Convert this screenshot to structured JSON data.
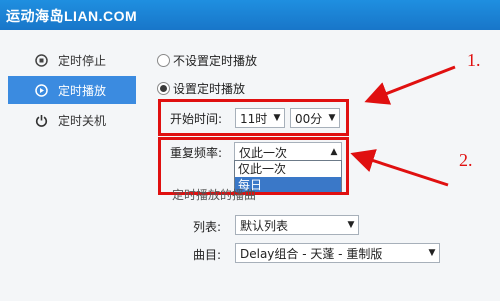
{
  "window": {
    "title": "运动海岛LIAN.COM"
  },
  "sidebar": {
    "items": [
      {
        "label": "定时停止",
        "icon": "stop-circle-icon",
        "active": false
      },
      {
        "label": "定时播放",
        "icon": "play-circle-icon",
        "active": true
      },
      {
        "label": "定时关机",
        "icon": "power-icon",
        "active": false
      }
    ]
  },
  "options": {
    "no_schedule": "不设置定时播放",
    "set_schedule": "设置定时播放",
    "selected": "设置定时播放"
  },
  "start_time": {
    "label": "开始时间:",
    "hour": "11时",
    "minute": "00分"
  },
  "repeat": {
    "label": "重复频率:",
    "value": "仅此一次",
    "options": [
      "仅此一次",
      "每日"
    ],
    "highlighted": "每日"
  },
  "playlist_section": {
    "heading": "定时播放的播曲",
    "list_label": "列表:",
    "list_value": "默认列表",
    "track_label": "曲目:",
    "track_value": "Delay组合 - 天蓬 - 重制版"
  },
  "annotations": {
    "one": "1.",
    "two": "2."
  },
  "colors": {
    "titlebar": "#1a82d6",
    "active_item": "#3b8be0",
    "annotation": "#e01010"
  }
}
